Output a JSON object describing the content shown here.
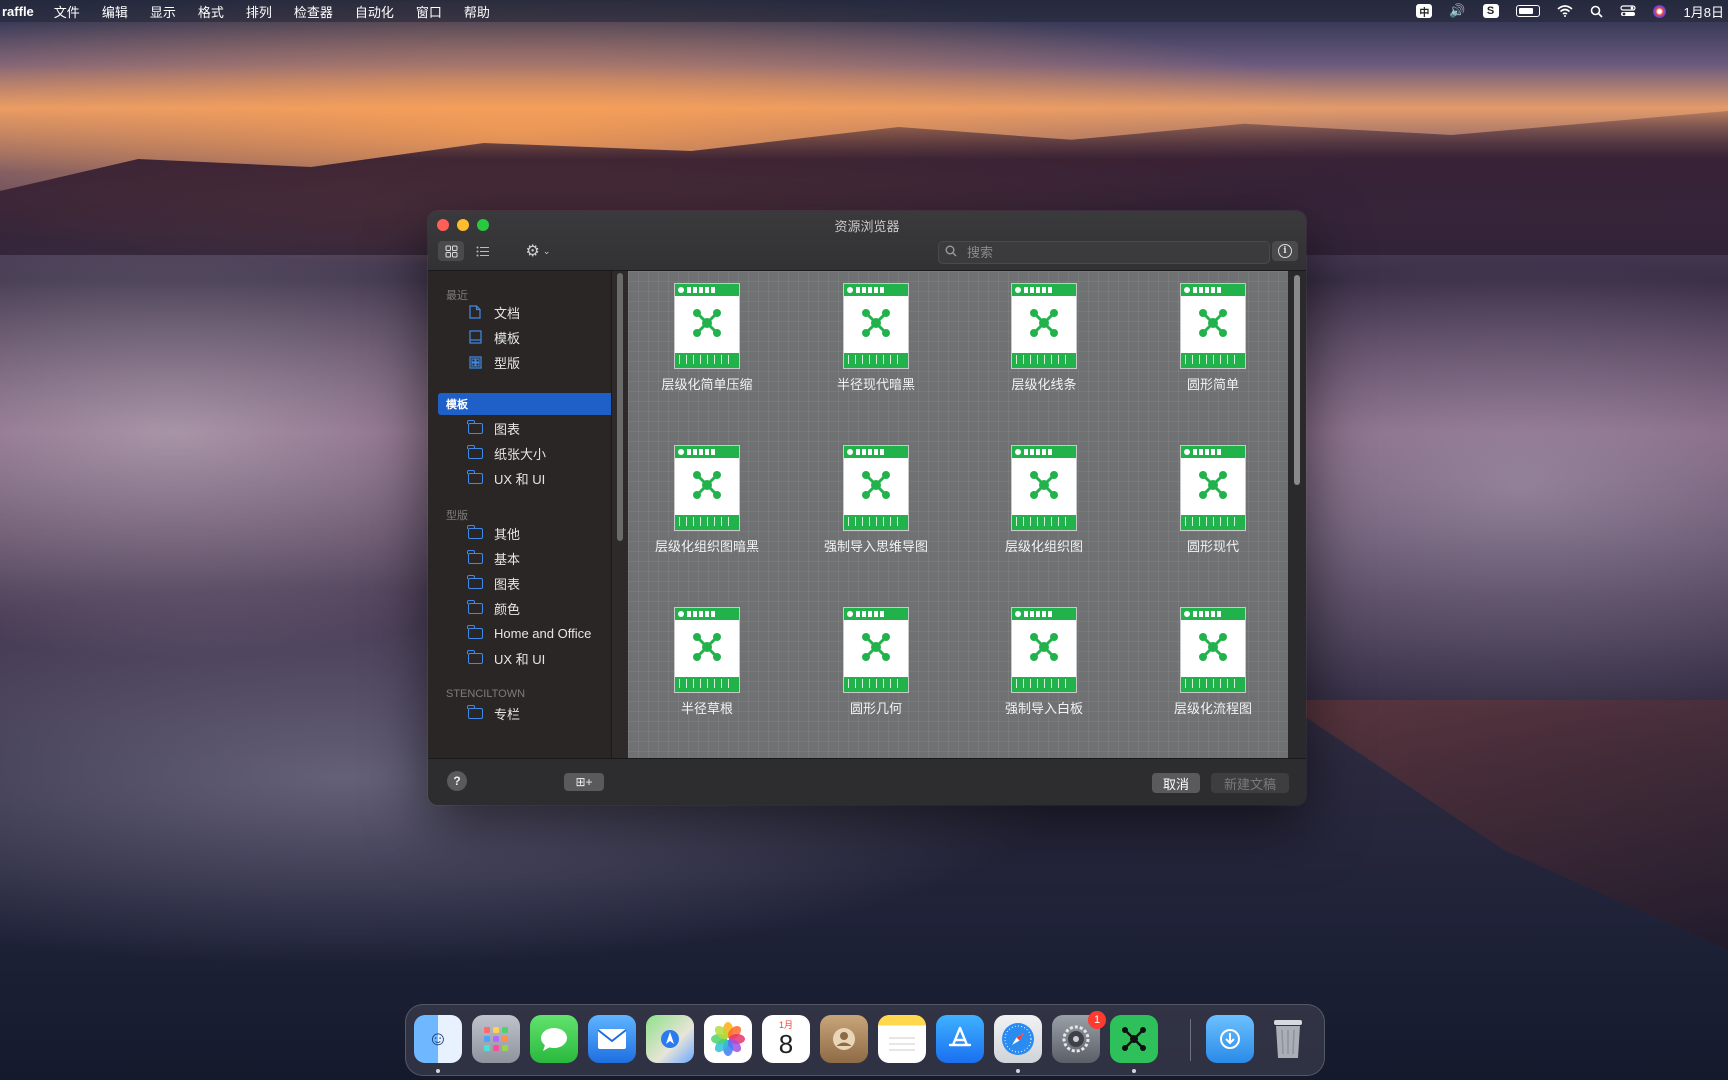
{
  "menubar": {
    "app": "raffle",
    "items": [
      "文件",
      "编辑",
      "显示",
      "格式",
      "排列",
      "检查器",
      "自动化",
      "窗口",
      "帮助"
    ],
    "tray": {
      "input_method": "中",
      "clock": "1月8日"
    }
  },
  "window": {
    "title": "资源浏览器",
    "search_placeholder": "搜索",
    "sidebar": {
      "sections": [
        {
          "label": "最近"
        },
        {
          "label": "型版"
        },
        {
          "label": "STENCILTOWN"
        }
      ],
      "recent_items": [
        "文档",
        "模板",
        "型版"
      ],
      "selected_header": "模板",
      "template_items": [
        "图表",
        "纸张大小",
        "UX 和 UI"
      ],
      "stencil_items": [
        "其他",
        "基本",
        "图表",
        "颜色",
        "Home and Office",
        "UX 和 UI"
      ],
      "stenciltown_items": [
        "专栏"
      ]
    },
    "templates": [
      "层级化简单压缩",
      "半径现代暗黑",
      "层级化线条",
      "圆形简单",
      "层级化组织图暗黑",
      "强制导入思维导图",
      "层级化组织图",
      "圆形现代",
      "半径草根",
      "圆形几何",
      "强制导入白板",
      "层级化流程图"
    ],
    "bottom": {
      "help": "?",
      "add": "⊞+",
      "cancel": "取消",
      "new_document": "新建文稿"
    }
  },
  "dock": {
    "apps": [
      "Finder",
      "Launchpad",
      "Messages",
      "Mail",
      "Maps",
      "Photos",
      "Calendar",
      "Contacts",
      "Notes",
      "App Store",
      "Safari",
      "System Settings",
      "OmniGraffle",
      "Downloads",
      "Trash"
    ],
    "calendar": {
      "month": "1月",
      "day": "8"
    },
    "settings_badge": "1"
  },
  "colors": {
    "accent": "#1f5fc8",
    "folder_icon": "#3f8ae8",
    "template_green": "#22b24c",
    "close": "#ff5f57",
    "minimize": "#febc2e",
    "zoom": "#28c840"
  }
}
